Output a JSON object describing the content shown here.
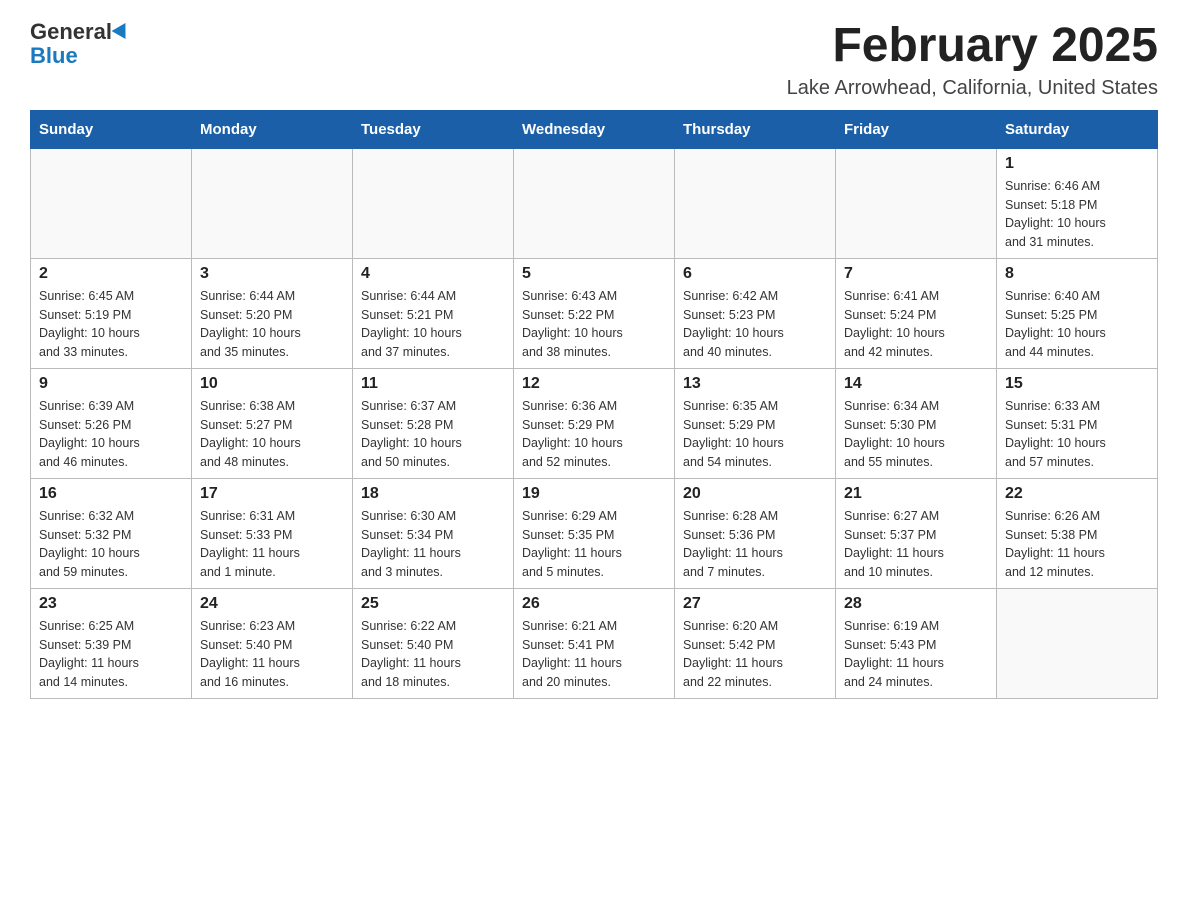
{
  "header": {
    "logo_general": "General",
    "logo_blue": "Blue",
    "month_title": "February 2025",
    "location": "Lake Arrowhead, California, United States"
  },
  "weekdays": [
    "Sunday",
    "Monday",
    "Tuesday",
    "Wednesday",
    "Thursday",
    "Friday",
    "Saturday"
  ],
  "weeks": [
    [
      {
        "day": "",
        "info": ""
      },
      {
        "day": "",
        "info": ""
      },
      {
        "day": "",
        "info": ""
      },
      {
        "day": "",
        "info": ""
      },
      {
        "day": "",
        "info": ""
      },
      {
        "day": "",
        "info": ""
      },
      {
        "day": "1",
        "info": "Sunrise: 6:46 AM\nSunset: 5:18 PM\nDaylight: 10 hours\nand 31 minutes."
      }
    ],
    [
      {
        "day": "2",
        "info": "Sunrise: 6:45 AM\nSunset: 5:19 PM\nDaylight: 10 hours\nand 33 minutes."
      },
      {
        "day": "3",
        "info": "Sunrise: 6:44 AM\nSunset: 5:20 PM\nDaylight: 10 hours\nand 35 minutes."
      },
      {
        "day": "4",
        "info": "Sunrise: 6:44 AM\nSunset: 5:21 PM\nDaylight: 10 hours\nand 37 minutes."
      },
      {
        "day": "5",
        "info": "Sunrise: 6:43 AM\nSunset: 5:22 PM\nDaylight: 10 hours\nand 38 minutes."
      },
      {
        "day": "6",
        "info": "Sunrise: 6:42 AM\nSunset: 5:23 PM\nDaylight: 10 hours\nand 40 minutes."
      },
      {
        "day": "7",
        "info": "Sunrise: 6:41 AM\nSunset: 5:24 PM\nDaylight: 10 hours\nand 42 minutes."
      },
      {
        "day": "8",
        "info": "Sunrise: 6:40 AM\nSunset: 5:25 PM\nDaylight: 10 hours\nand 44 minutes."
      }
    ],
    [
      {
        "day": "9",
        "info": "Sunrise: 6:39 AM\nSunset: 5:26 PM\nDaylight: 10 hours\nand 46 minutes."
      },
      {
        "day": "10",
        "info": "Sunrise: 6:38 AM\nSunset: 5:27 PM\nDaylight: 10 hours\nand 48 minutes."
      },
      {
        "day": "11",
        "info": "Sunrise: 6:37 AM\nSunset: 5:28 PM\nDaylight: 10 hours\nand 50 minutes."
      },
      {
        "day": "12",
        "info": "Sunrise: 6:36 AM\nSunset: 5:29 PM\nDaylight: 10 hours\nand 52 minutes."
      },
      {
        "day": "13",
        "info": "Sunrise: 6:35 AM\nSunset: 5:29 PM\nDaylight: 10 hours\nand 54 minutes."
      },
      {
        "day": "14",
        "info": "Sunrise: 6:34 AM\nSunset: 5:30 PM\nDaylight: 10 hours\nand 55 minutes."
      },
      {
        "day": "15",
        "info": "Sunrise: 6:33 AM\nSunset: 5:31 PM\nDaylight: 10 hours\nand 57 minutes."
      }
    ],
    [
      {
        "day": "16",
        "info": "Sunrise: 6:32 AM\nSunset: 5:32 PM\nDaylight: 10 hours\nand 59 minutes."
      },
      {
        "day": "17",
        "info": "Sunrise: 6:31 AM\nSunset: 5:33 PM\nDaylight: 11 hours\nand 1 minute."
      },
      {
        "day": "18",
        "info": "Sunrise: 6:30 AM\nSunset: 5:34 PM\nDaylight: 11 hours\nand 3 minutes."
      },
      {
        "day": "19",
        "info": "Sunrise: 6:29 AM\nSunset: 5:35 PM\nDaylight: 11 hours\nand 5 minutes."
      },
      {
        "day": "20",
        "info": "Sunrise: 6:28 AM\nSunset: 5:36 PM\nDaylight: 11 hours\nand 7 minutes."
      },
      {
        "day": "21",
        "info": "Sunrise: 6:27 AM\nSunset: 5:37 PM\nDaylight: 11 hours\nand 10 minutes."
      },
      {
        "day": "22",
        "info": "Sunrise: 6:26 AM\nSunset: 5:38 PM\nDaylight: 11 hours\nand 12 minutes."
      }
    ],
    [
      {
        "day": "23",
        "info": "Sunrise: 6:25 AM\nSunset: 5:39 PM\nDaylight: 11 hours\nand 14 minutes."
      },
      {
        "day": "24",
        "info": "Sunrise: 6:23 AM\nSunset: 5:40 PM\nDaylight: 11 hours\nand 16 minutes."
      },
      {
        "day": "25",
        "info": "Sunrise: 6:22 AM\nSunset: 5:40 PM\nDaylight: 11 hours\nand 18 minutes."
      },
      {
        "day": "26",
        "info": "Sunrise: 6:21 AM\nSunset: 5:41 PM\nDaylight: 11 hours\nand 20 minutes."
      },
      {
        "day": "27",
        "info": "Sunrise: 6:20 AM\nSunset: 5:42 PM\nDaylight: 11 hours\nand 22 minutes."
      },
      {
        "day": "28",
        "info": "Sunrise: 6:19 AM\nSunset: 5:43 PM\nDaylight: 11 hours\nand 24 minutes."
      },
      {
        "day": "",
        "info": ""
      }
    ]
  ]
}
